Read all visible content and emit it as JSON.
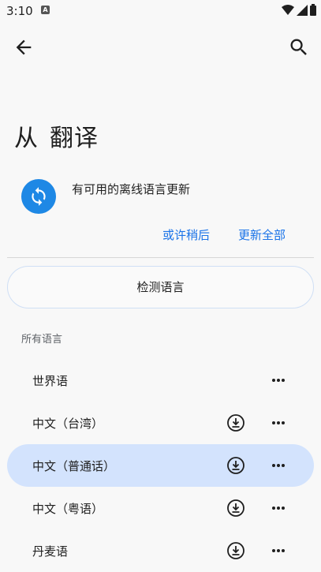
{
  "status_bar": {
    "time": "3:10",
    "notification_badge": "A",
    "icons": [
      "wifi-icon",
      "signal-icon",
      "battery-icon"
    ]
  },
  "top_bar": {
    "back_icon": "arrow-left-icon",
    "search_icon": "search-icon"
  },
  "title": {
    "from": "从",
    "to": "翻译"
  },
  "update_card": {
    "icon": "sync-icon",
    "message": "有可用的离线语言更新",
    "later_label": "或许稍后",
    "update_all_label": "更新全部"
  },
  "detect_button_label": "检测语言",
  "section_label": "所有语言",
  "languages": [
    {
      "name": "世界语",
      "downloadable": false,
      "selected": false
    },
    {
      "name": "中文（台湾）",
      "downloadable": true,
      "selected": false
    },
    {
      "name": "中文（普通话）",
      "downloadable": true,
      "selected": true
    },
    {
      "name": "中文（粤语）",
      "downloadable": true,
      "selected": false
    },
    {
      "name": "丹麦语",
      "downloadable": true,
      "selected": false
    }
  ],
  "colors": {
    "accent": "#1a73e8",
    "sync_icon_bg": "#1e88e5",
    "selected_row": "#d3e3fd",
    "background": "#f8f8f8"
  }
}
